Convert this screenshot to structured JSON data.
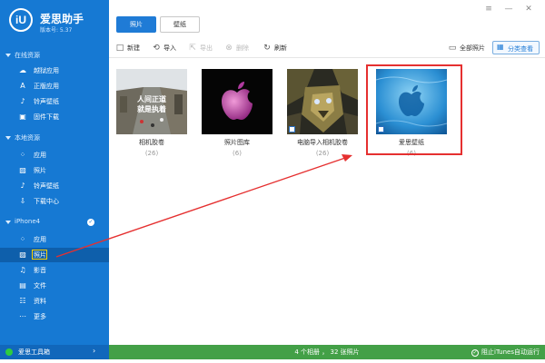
{
  "app": {
    "name": "爱思助手",
    "logo_text": "iU",
    "version": "版本号: 5.37"
  },
  "window_controls": [
    "≡",
    "—",
    "✕"
  ],
  "sidebar": {
    "sections": [
      {
        "label": "在线资源",
        "items": [
          {
            "label": "越狱应用",
            "icon": "cloud-icon"
          },
          {
            "label": "正版应用",
            "icon": "appstore-icon"
          },
          {
            "label": "铃声壁纸",
            "icon": "ringtone-icon"
          },
          {
            "label": "固件下载",
            "icon": "box-icon"
          }
        ]
      },
      {
        "label": "本地资源",
        "items": [
          {
            "label": "应用",
            "icon": "apps-icon"
          },
          {
            "label": "照片",
            "icon": "photo-icon"
          },
          {
            "label": "铃声壁纸",
            "icon": "ringtone-icon"
          },
          {
            "label": "下载中心",
            "icon": "download-icon"
          }
        ]
      },
      {
        "label": "iPhone4",
        "items": [
          {
            "label": "应用",
            "icon": "apps-icon"
          },
          {
            "label": "照片",
            "icon": "photo-icon"
          },
          {
            "label": "影音",
            "icon": "music-icon"
          },
          {
            "label": "文件",
            "icon": "file-icon"
          },
          {
            "label": "资料",
            "icon": "contacts-icon"
          },
          {
            "label": "更多",
            "icon": "more-icon"
          }
        ]
      }
    ],
    "toolbox_label": "爱思工具箱"
  },
  "tabs": [
    {
      "label": "照片"
    },
    {
      "label": "壁纸"
    }
  ],
  "toolbar": {
    "new_label": "新建",
    "import_label": "导入",
    "export_label": "导出",
    "delete_label": "删除",
    "refresh_label": "刷新",
    "all_photos_label": "全部照片",
    "category_view_label": "分类查看"
  },
  "albums": [
    {
      "name": "相机胶卷",
      "count": "(26)",
      "thumb_text": "人间正道\n就是执着"
    },
    {
      "name": "照片图库",
      "count": "(6)"
    },
    {
      "name": "电脑导入相机胶卷",
      "count": "(26)"
    },
    {
      "name": "爱思壁纸",
      "count": "(6)"
    }
  ],
  "status": {
    "summary": "4 个相册 ， 32 张照片",
    "itunes_label": "阻止iTunes自动运行"
  },
  "colors": {
    "sidebar": "#1679d3",
    "accent": "#1f7bd6",
    "status_bar": "#43a047",
    "annotation_red": "#e53030"
  }
}
